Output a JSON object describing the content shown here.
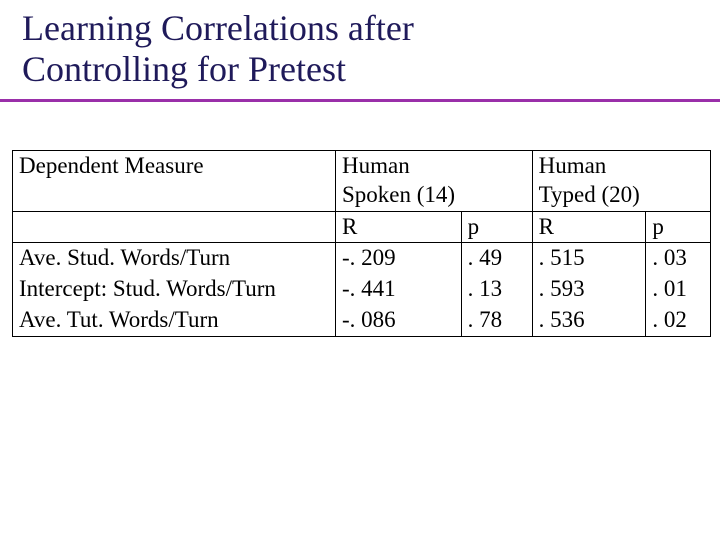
{
  "title_line1": "Learning Correlations after",
  "title_line2": "Controlling for Pretest",
  "header": {
    "dep": "Dependent Measure",
    "spoken_top": "Human\nSpoken (14)",
    "typed_top": "Human\nTyped (20)",
    "R": "R",
    "p": "p"
  },
  "rows": [
    {
      "label": "Ave. Stud. Words/Turn",
      "sR": "-. 209",
      "sp": ". 49",
      "tR": ". 515",
      "tp": ". 03"
    },
    {
      "label": "Intercept: Stud. Words/Turn",
      "sR": "-. 441",
      "sp": ". 13",
      "tR": ". 593",
      "tp": ". 01"
    },
    {
      "label": "Ave. Tut. Words/Turn",
      "sR": "-. 086",
      "sp": ". 78",
      "tR": ". 536",
      "tp": ". 02"
    }
  ],
  "chart_data": {
    "type": "table",
    "title": "Learning Correlations after Controlling for Pretest",
    "columns": [
      "Dependent Measure",
      "Human Spoken (14) R",
      "Human Spoken (14) p",
      "Human Typed (20) R",
      "Human Typed (20) p"
    ],
    "rows": [
      [
        "Ave. Stud. Words/Turn",
        -0.209,
        0.49,
        0.515,
        0.03
      ],
      [
        "Intercept: Stud. Words/Turn",
        -0.441,
        0.13,
        0.593,
        0.01
      ],
      [
        "Ave. Tut. Words/Turn",
        -0.086,
        0.78,
        0.536,
        0.02
      ]
    ]
  }
}
